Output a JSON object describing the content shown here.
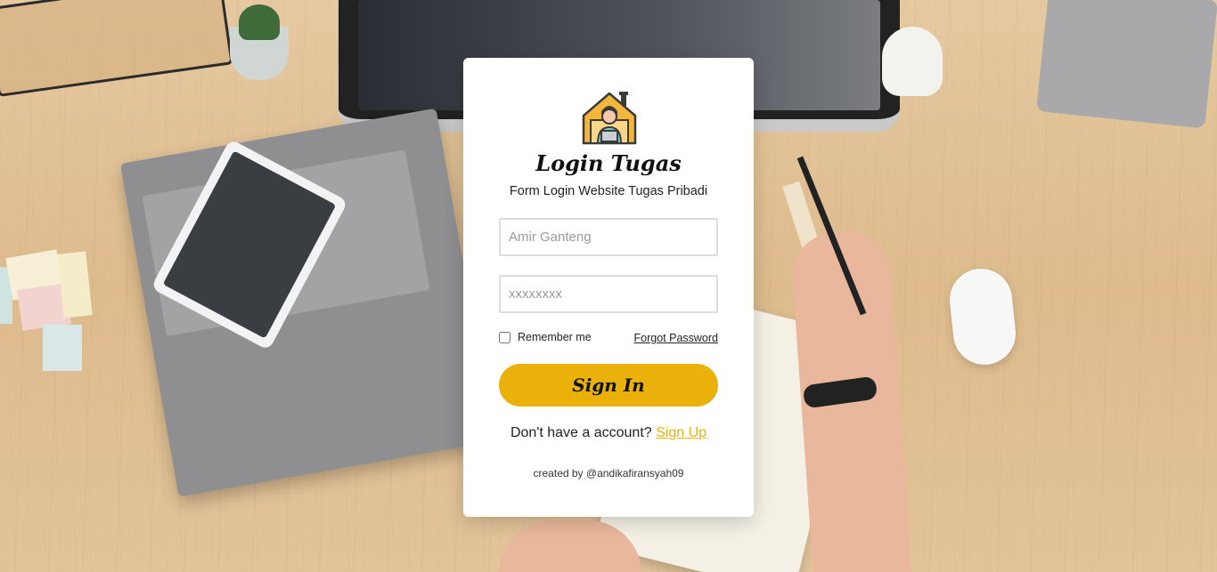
{
  "login_card": {
    "logo_icon": "house-with-person-at-laptop-icon",
    "title": "Login Tugas",
    "subtitle": "Form Login Website Tugas Pribadi",
    "username_placeholder": "Amir Ganteng",
    "password_placeholder": "xxxxxxxx",
    "remember_label": "Remember me",
    "remember_checked": false,
    "forgot_label": "Forgot Password",
    "signin_label": "Sign In",
    "signup_prompt": "Don't have a account?",
    "signup_label": "Sign Up",
    "credit": "created by @andikafiransyah09"
  },
  "colors": {
    "accent": "#e9b10a",
    "card_background": "#ffffff",
    "field_border": "#dcdcdc"
  }
}
